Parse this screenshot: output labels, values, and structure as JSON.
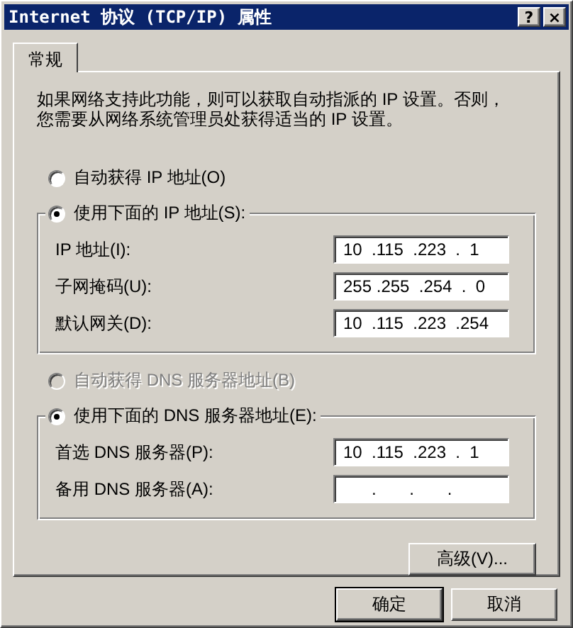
{
  "window": {
    "title": "Internet 协议 (TCP/IP) 属性",
    "help": "?",
    "close": "×"
  },
  "tabs": [
    {
      "label": "常规",
      "selected": true
    }
  ],
  "description": "如果网络支持此功能，则可以获取自动指派的 IP 设置。否则，您需要从网络系统管理员处获得适当的 IP 设置。",
  "ip_mode": [
    {
      "label": "自动获得 IP 地址(O)",
      "selected": false,
      "disabled": false
    },
    {
      "label": "使用下面的 IP 地址(S):",
      "selected": true,
      "disabled": false
    }
  ],
  "ip_fields": [
    {
      "label": "IP 地址(I):",
      "value": "10  .115  .223  .  1"
    },
    {
      "label": "子网掩码(U):",
      "value": "255 .255  .254  .  0"
    },
    {
      "label": "默认网关(D):",
      "value": "10  .115  .223  .254"
    }
  ],
  "dns_mode": [
    {
      "label": "自动获得 DNS 服务器地址(B)",
      "selected": false,
      "disabled": true
    },
    {
      "label": "使用下面的 DNS 服务器地址(E):",
      "selected": true,
      "disabled": false
    }
  ],
  "dns_fields": [
    {
      "label": "首选 DNS 服务器(P):",
      "value": "10  .115  .223  .  1"
    },
    {
      "label": "备用 DNS 服务器(A):",
      "value": "      .       .       ."
    }
  ],
  "advanced_button": "高级(V)...",
  "buttons": [
    {
      "label": "确定",
      "default": true
    },
    {
      "label": "取消",
      "default": false
    }
  ]
}
